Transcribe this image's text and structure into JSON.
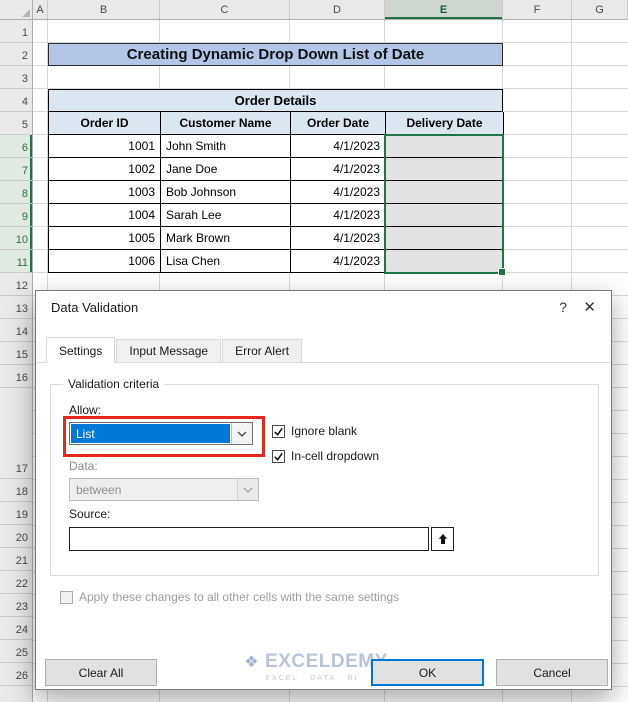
{
  "spreadsheet": {
    "column_headers": [
      "A",
      "B",
      "C",
      "D",
      "E",
      "F",
      "G"
    ],
    "selected_column": "E",
    "row_numbers": [
      1,
      2,
      3,
      4,
      5,
      6,
      7,
      8,
      9,
      10,
      11,
      12,
      13,
      14,
      15,
      16,
      17,
      18,
      19,
      20,
      21,
      22,
      23,
      24,
      25,
      26
    ],
    "selected_rows": [
      6,
      7,
      8,
      9,
      10,
      11
    ],
    "sheet_title": "Creating Dynamic Drop Down List of Date",
    "table": {
      "title": "Order Details",
      "headers": [
        "Order ID",
        "Customer Name",
        "Order Date",
        "Delivery Date"
      ],
      "rows": [
        [
          "1001",
          "John Smith",
          "4/1/2023",
          ""
        ],
        [
          "1002",
          "Jane Doe",
          "4/1/2023",
          ""
        ],
        [
          "1003",
          "Bob Johnson",
          "4/1/2023",
          ""
        ],
        [
          "1004",
          "Sarah Lee",
          "4/1/2023",
          ""
        ],
        [
          "1005",
          "Mark Brown",
          "4/1/2023",
          ""
        ],
        [
          "1006",
          "Lisa Chen",
          "4/1/2023",
          ""
        ]
      ]
    }
  },
  "dialog": {
    "title": "Data Validation",
    "help_button": "?",
    "close_button": "✕",
    "tabs": [
      {
        "label": "Settings",
        "active": true
      },
      {
        "label": "Input Message",
        "active": false
      },
      {
        "label": "Error Alert",
        "active": false
      }
    ],
    "validation_criteria_label": "Validation criteria",
    "allow_label": "Allow:",
    "allow_value": "List",
    "ignore_blank": {
      "label": "Ignore blank",
      "checked": true
    },
    "in_cell_dropdown": {
      "label": "In-cell dropdown",
      "checked": true
    },
    "data_label": "Data:",
    "data_value": "between",
    "source_label": "Source:",
    "source_value": "",
    "apply_checkbox": {
      "label": "Apply these changes to all other cells with the same settings",
      "checked": false
    },
    "buttons": {
      "clear_all": "Clear All",
      "ok": "OK",
      "cancel": "Cancel"
    },
    "watermark": {
      "logo": "❖",
      "name": "EXCELDEMY",
      "tagline": "EXCEL · DATA · BI ·"
    }
  },
  "colors": {
    "selection_green": "#217346",
    "accent_blue": "#0078d7",
    "annotation_red": "#e8261d",
    "title_fill": "#b4c6e7",
    "table_header_fill": "#dce6f1"
  }
}
